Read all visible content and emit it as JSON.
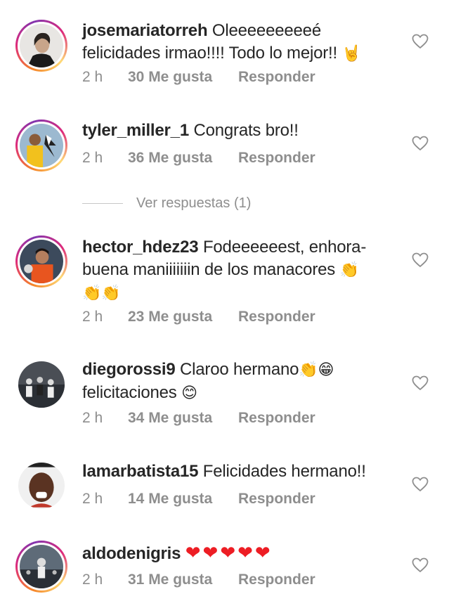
{
  "comments": [
    {
      "username": "josemariatorreh",
      "text": "Oleeeeeeeeeé felicidades irmao!!!! Todo lo mejor!!",
      "emoji": "🤘",
      "time": "2 h",
      "likes": "30 Me gusta",
      "reply": "Responder",
      "story_ring": true
    },
    {
      "username": "tyler_miller_1",
      "text": "Congrats bro!!",
      "emoji": "",
      "time": "2 h",
      "likes": "36 Me gusta",
      "reply": "Responder",
      "story_ring": true
    },
    {
      "username": "hector_hdez23",
      "text_line1": "Fodeeeeeest, enhora-",
      "text_line2": "buena maniiiiiiin de los manacores",
      "emoji_line2": "👏",
      "emoji_line3": "👏👏",
      "time": "2 h",
      "likes": "23 Me gusta",
      "reply": "Responder",
      "story_ring": true
    },
    {
      "username": "diegorossi9",
      "text_line1": "Claroo hermano",
      "emoji_line1": "👏😁",
      "text_line2": "felicitaciones",
      "emoji_line2": "😊",
      "time": "2 h",
      "likes": "34 Me gusta",
      "reply": "Responder",
      "story_ring": false
    },
    {
      "username": "lamarbatista15",
      "text": "Felicidades hermano!!",
      "time": "2 h",
      "likes": "14 Me gusta",
      "reply": "Responder",
      "story_ring": false
    },
    {
      "username": "aldodenigris",
      "text": "",
      "emoji": "❤❤❤❤❤",
      "time": "2 h",
      "likes": "31 Me gusta",
      "reply": "Responder",
      "story_ring": true
    }
  ],
  "view_replies": "Ver respuestas (1)",
  "colors": {
    "text": "#262626",
    "secondary": "#8e8e8e",
    "heart_red": "#ed1d24",
    "ring_orange": "#f58529",
    "ring_pink": "#dd2a7b"
  }
}
